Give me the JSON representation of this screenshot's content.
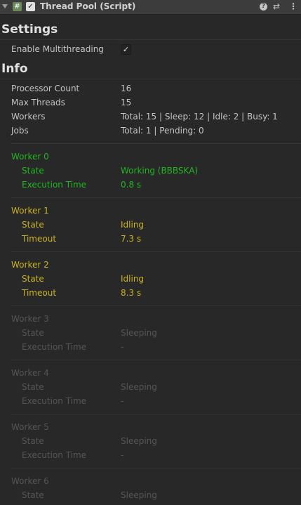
{
  "header": {
    "title": "Thread Pool (Script)",
    "script_icon": "#",
    "enabled_check": "✓",
    "icons": [
      "foldout-arrow-icon",
      "script-icon",
      "help-icon",
      "preset-icon",
      "menu-icon"
    ]
  },
  "settings": {
    "title": "Settings",
    "multithreading_label": "Enable Multithreading",
    "multithreading_checked": true
  },
  "info": {
    "title": "Info",
    "rows": [
      {
        "label": "Processor Count",
        "value": "16"
      },
      {
        "label": "Max Threads",
        "value": "15"
      },
      {
        "label": "Workers",
        "value": "Total: 15  | Sleep: 12 | Idle: 2 | Busy: 1"
      },
      {
        "label": "Jobs",
        "value": "Total: 1 | Pending: 0"
      }
    ]
  },
  "workers": [
    {
      "name": "Worker 0",
      "status": "busy",
      "state_label": "State",
      "state": "Working (BBBSKA)",
      "time_label": "Execution Time",
      "time": "0.8 s"
    },
    {
      "name": "Worker 1",
      "status": "idle",
      "state_label": "State",
      "state": "Idling",
      "time_label": "Timeout",
      "time": "7.3 s"
    },
    {
      "name": "Worker 2",
      "status": "idle",
      "state_label": "State",
      "state": "Idling",
      "time_label": "Timeout",
      "time": "8.3 s"
    },
    {
      "name": "Worker 3",
      "status": "sleep",
      "state_label": "State",
      "state": "Sleeping",
      "time_label": "Execution Time",
      "time": "-"
    },
    {
      "name": "Worker 4",
      "status": "sleep",
      "state_label": "State",
      "state": "Sleeping",
      "time_label": "Execution Time",
      "time": "-"
    },
    {
      "name": "Worker 5",
      "status": "sleep",
      "state_label": "State",
      "state": "Sleeping",
      "time_label": "Execution Time",
      "time": "-"
    },
    {
      "name": "Worker 6",
      "status": "sleep",
      "state_label": "State",
      "state": "Sleeping"
    }
  ],
  "colors": {
    "busy": "#22b522",
    "idle": "#c9b227",
    "sleep": "#555555",
    "background": "#282828"
  }
}
